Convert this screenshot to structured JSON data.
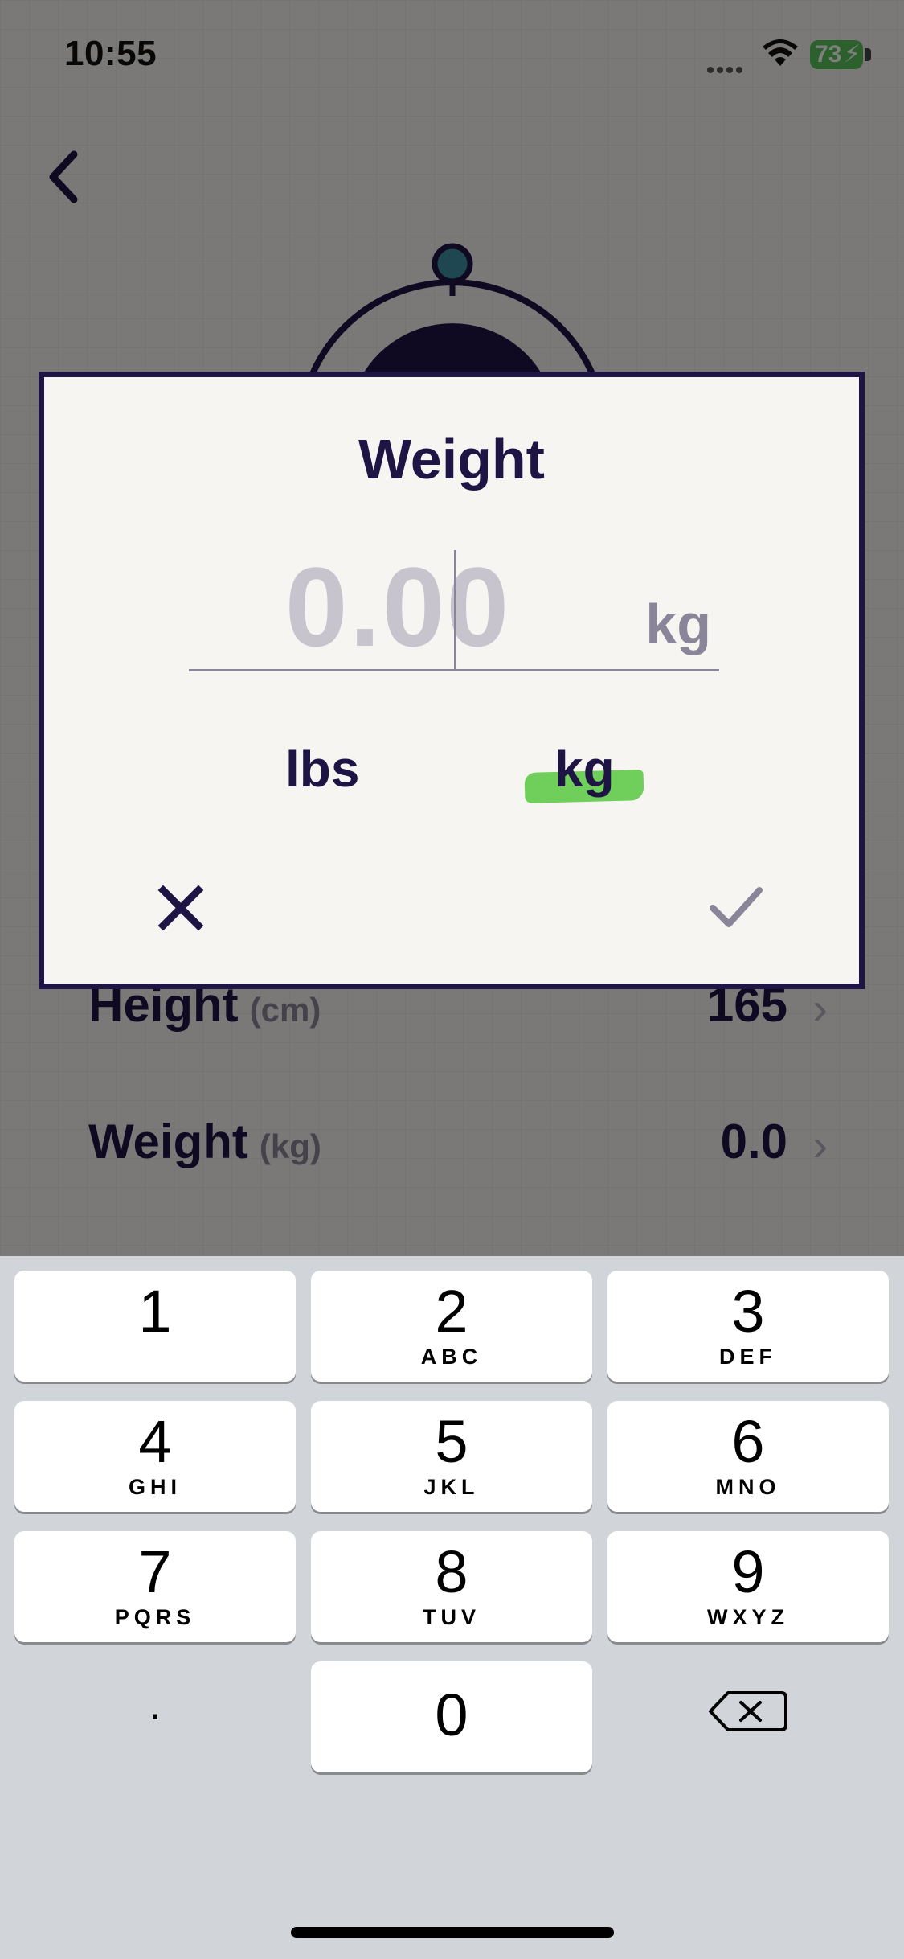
{
  "status_bar": {
    "time": "10:55",
    "battery": "73"
  },
  "background_screen": {
    "rows": [
      {
        "label": "Height",
        "unit": "(cm)",
        "value": "165"
      },
      {
        "label": "Weight",
        "unit": "(kg)",
        "value": "0.0"
      }
    ]
  },
  "dialog": {
    "title": "Weight",
    "input_value": "0.00",
    "input_unit": "kg",
    "unit_options": [
      "lbs",
      "kg"
    ],
    "selected_unit": "kg",
    "accent_color": "#6fcf5a",
    "text_color": "#1e1544"
  },
  "keyboard": {
    "keys": [
      {
        "num": "1",
        "letters": ""
      },
      {
        "num": "2",
        "letters": "ABC"
      },
      {
        "num": "3",
        "letters": "DEF"
      },
      {
        "num": "4",
        "letters": "GHI"
      },
      {
        "num": "5",
        "letters": "JKL"
      },
      {
        "num": "6",
        "letters": "MNO"
      },
      {
        "num": "7",
        "letters": "PQRS"
      },
      {
        "num": "8",
        "letters": "TUV"
      },
      {
        "num": "9",
        "letters": "WXYZ"
      }
    ],
    "dot": ".",
    "zero": "0"
  }
}
